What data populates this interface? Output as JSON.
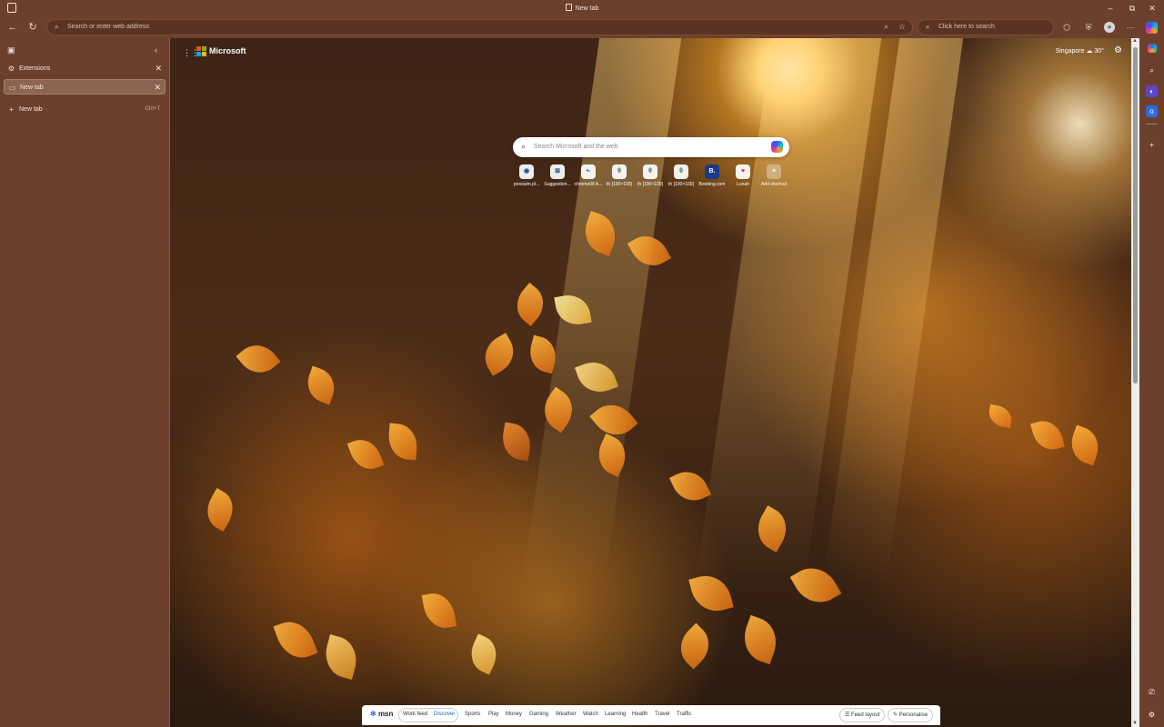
{
  "window": {
    "title": "New tab"
  },
  "address_bar": {
    "placeholder": "Search or enter web address"
  },
  "search_box": {
    "placeholder": "Click here to search"
  },
  "tab_pane": {
    "tabs": [
      {
        "label": "Extensions",
        "active": false
      },
      {
        "label": "New tab",
        "active": true
      }
    ],
    "new_tab": {
      "label": "New tab",
      "shortcut": "Ctrl+T"
    }
  },
  "ntp": {
    "brand": "Microsoft",
    "location": "Singapore",
    "temperature": "30°",
    "search_placeholder": "Search Microsoft and the web",
    "quick_links": [
      {
        "label": "proxiuim.pl...",
        "icon": "shield-icon",
        "tile_text": "◉"
      },
      {
        "label": "Suggestion...",
        "icon": "teams-icon",
        "tile_text": "⊠"
      },
      {
        "label": "chrome08 A...",
        "icon": "link-icon",
        "tile_text": "•-"
      },
      {
        "label": "th [100×100]",
        "icon": "site-icon",
        "tile_text": "θ"
      },
      {
        "label": "th [100×100]",
        "icon": "site-icon",
        "tile_text": "θ"
      },
      {
        "label": "th [100×100]",
        "icon": "site-icon",
        "tile_text": "θ"
      },
      {
        "label": "Booking.com",
        "icon": "booking-icon",
        "tile_text": "B."
      },
      {
        "label": "Lunah",
        "icon": "heart-icon",
        "tile_text": "♥"
      },
      {
        "label": "Add shortcut",
        "icon": "plus-icon",
        "tile_text": "+"
      }
    ]
  },
  "msn_bar": {
    "brand": "msn",
    "tabs": [
      "Work feed",
      "Discover",
      "Sports",
      "Play",
      "Money",
      "Gaming",
      "Weather",
      "Watch",
      "Learning",
      "Health",
      "Travel",
      "Traffic"
    ],
    "selected": "Discover",
    "feed_layout_label": "Feed layout",
    "personalise_label": "Personalise"
  },
  "colors": {
    "chrome": "#6d402d",
    "active_tab": "#8c6451",
    "accent": "#1d5fd6"
  }
}
